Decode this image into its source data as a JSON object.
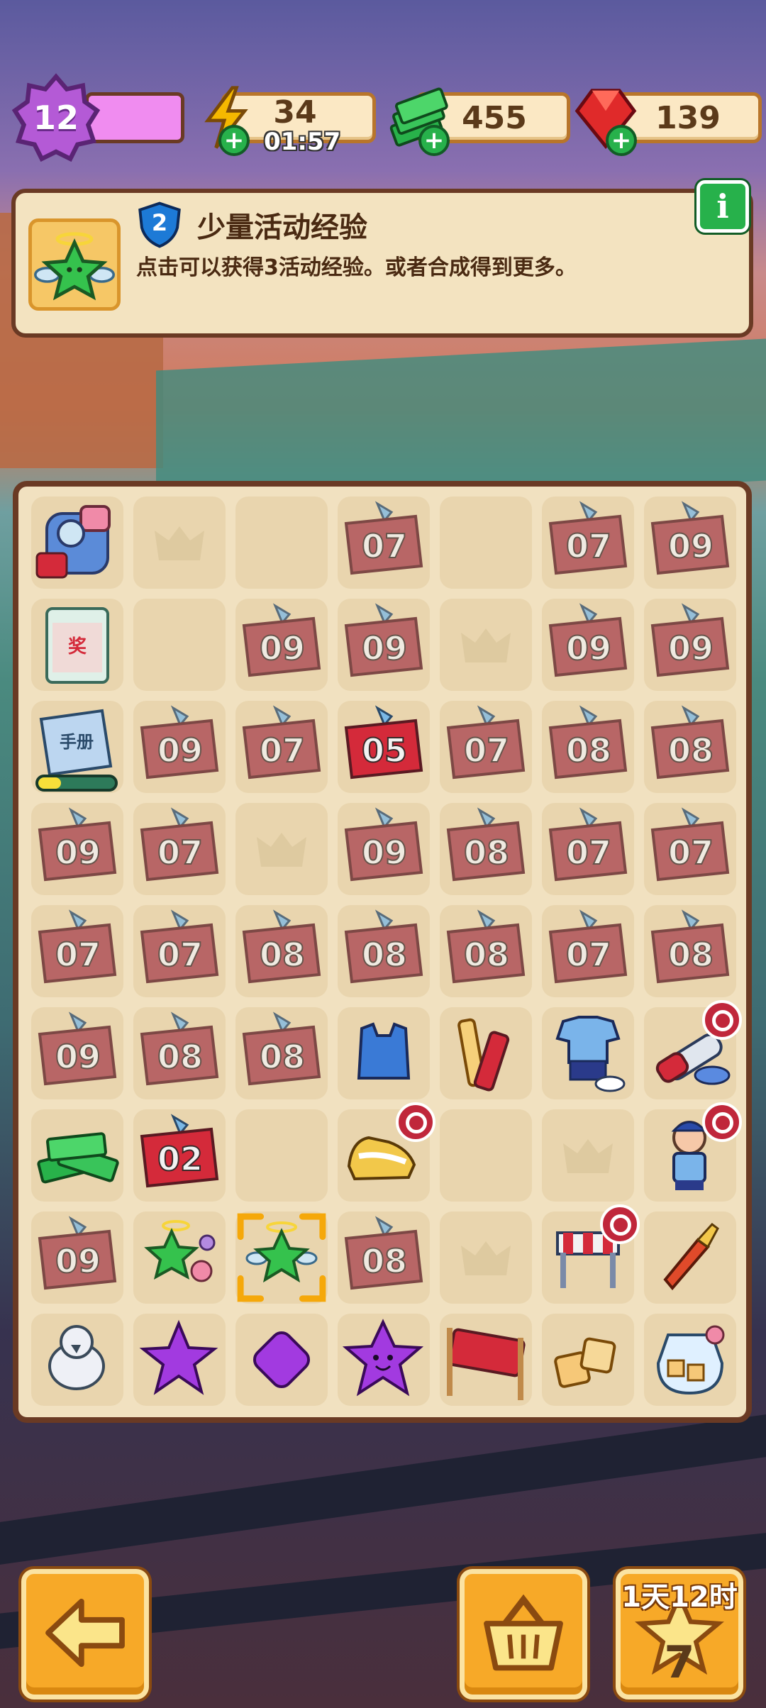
{
  "hud": {
    "level": "12",
    "energy": {
      "value": "34",
      "timer": "01:57",
      "icon": "lightning-icon"
    },
    "cash": {
      "value": "455",
      "icon": "cash-stack-icon"
    },
    "gems": {
      "value": "139",
      "icon": "ruby-gem-icon"
    }
  },
  "info": {
    "badge_level": "2",
    "title": "少量活动经验",
    "description": "点击可以获得3活动经验。或者合成得到更多。",
    "info_button": "i",
    "item_icon": "winged-star-icon"
  },
  "board": {
    "rows": [
      [
        "backpack-generator",
        "empty-crown",
        "empty",
        "ticket-07",
        "empty",
        "ticket-07",
        "ticket-09"
      ],
      [
        "prize-box-generator",
        "empty",
        "ticket-09",
        "ticket-09",
        "empty-crown",
        "ticket-09",
        "ticket-09"
      ],
      [
        "booklet-generator",
        "ticket-09",
        "ticket-07",
        "ticket-05-active",
        "ticket-07",
        "ticket-08",
        "ticket-08"
      ],
      [
        "ticket-09",
        "ticket-07",
        "empty-crown",
        "ticket-09",
        "ticket-08",
        "ticket-07",
        "ticket-07"
      ],
      [
        "ticket-07",
        "ticket-07",
        "ticket-08",
        "ticket-08",
        "ticket-08",
        "ticket-07",
        "ticket-08"
      ],
      [
        "ticket-09",
        "ticket-08",
        "ticket-08",
        "blue-bag",
        "cheer-sticks",
        "jersey-set",
        "sports-bottle-locked"
      ],
      [
        "cash-pile",
        "ticket-02-active",
        "empty",
        "sneakers-locked",
        "empty",
        "empty-crown",
        "player-figure-locked"
      ],
      [
        "ticket-09",
        "winged-star-cluster",
        "winged-star-selected",
        "ticket-08",
        "empty-crown",
        "hurdle-locked",
        "megaphone"
      ],
      [
        "duck",
        "purple-star",
        "purple-gem",
        "purple-star-face",
        "cheer-banner",
        "sugar-cubes",
        "candy-jar"
      ]
    ],
    "booklet_progress": 0.3
  },
  "buttons": {
    "back": {
      "icon": "arrow-left-icon"
    },
    "basket": {
      "icon": "basket-icon"
    },
    "reward": {
      "label": "1天12时",
      "count": "7",
      "icon": "star-icon"
    }
  },
  "colors": {
    "panel": "#f3e3c0",
    "border": "#6a3a24",
    "accent": "#f7a928",
    "green": "#27b14b"
  }
}
